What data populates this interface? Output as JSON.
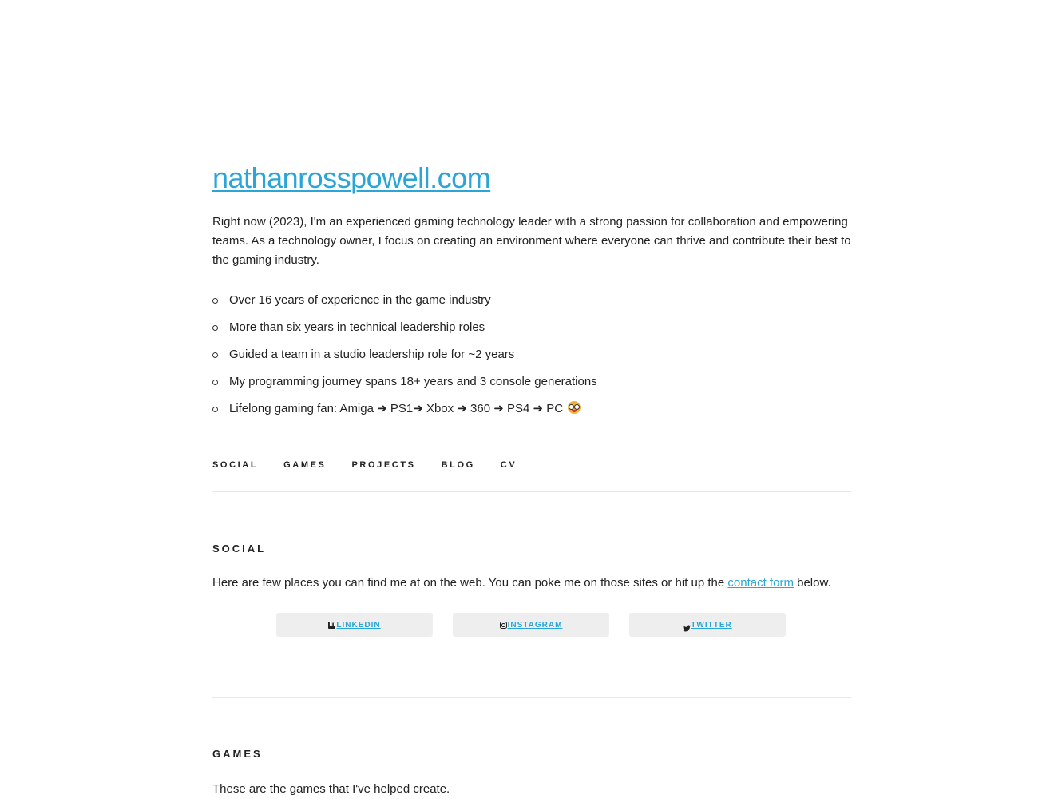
{
  "site": {
    "title": "nathanrosspowell.com"
  },
  "intro": {
    "text": "Right now (2023), I'm an experienced gaming technology leader with a strong passion for collaboration and empowering teams. As a technology owner, I focus on creating an environment where everyone can thrive and contribute their best to the gaming industry."
  },
  "facts": [
    "Over 16 years of experience in the game industry",
    "More than six years in technical leadership roles",
    "Guided a team in a studio leadership role for ~2 years",
    "My programming journey spans 18+ years and 3 console generations",
    "Lifelong gaming fan: Amiga ➜ PS1➜ Xbox ➜ 360 ➜ PS4 ➜ PC"
  ],
  "facts_emoji_icon": "nerd-face-icon",
  "nav": {
    "items": [
      "SOCIAL",
      "GAMES",
      "PROJECTS",
      "BLOG",
      "CV"
    ]
  },
  "social": {
    "heading": "SOCIAL",
    "text_before": "Here are few places you can find me at on the web. You can poke me on those sites or hit up the ",
    "link_text": "contact form",
    "text_after": " below.",
    "buttons": [
      {
        "label": "LINKEDIN",
        "icon": "linkedin-icon"
      },
      {
        "label": "INSTAGRAM",
        "icon": "instagram-icon"
      },
      {
        "label": "TWITTER",
        "icon": "twitter-icon"
      }
    ]
  },
  "games": {
    "heading": "GAMES",
    "text": "These are the games that I've helped create."
  },
  "colors": {
    "link": "#2aa5d6",
    "text": "#222222",
    "button_bg": "#eeeeee",
    "rule": "#e8e8e8"
  }
}
